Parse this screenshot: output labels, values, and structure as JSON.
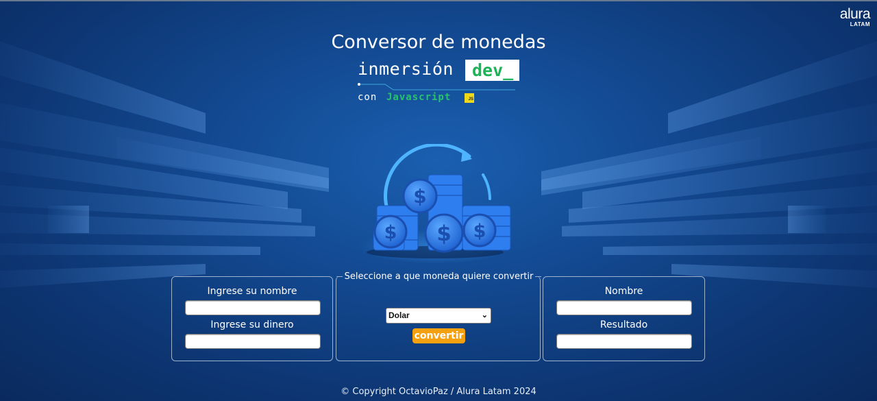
{
  "logo": {
    "main": "alura",
    "sub": "LATAM"
  },
  "header": {
    "title": "Conversor de monedas",
    "brand_word": "inmersión",
    "brand_tag": "dev_",
    "tagline_prefix": "con",
    "tagline_lang": "Javascript",
    "js_badge": "JS"
  },
  "form": {
    "left": {
      "name_label": "Ingrese su nombre",
      "name_value": "",
      "money_label": "Ingrese su dinero",
      "money_value": ""
    },
    "center": {
      "legend": "Seleccione a que moneda quiere convertir",
      "selected_currency": "Dolar",
      "convert_button": "convertir"
    },
    "right": {
      "name_label": "Nombre",
      "name_value": "",
      "result_label": "Resultado",
      "result_value": ""
    }
  },
  "footer": {
    "text": "© Copyright OctavioPaz / Alura Latam 2024"
  },
  "colors": {
    "background": "#134a92",
    "accent_button": "#f5a00f",
    "dev_green": "#1fb25a",
    "js_yellow": "#f0d91a",
    "panel_border": "#9fb3cf"
  }
}
